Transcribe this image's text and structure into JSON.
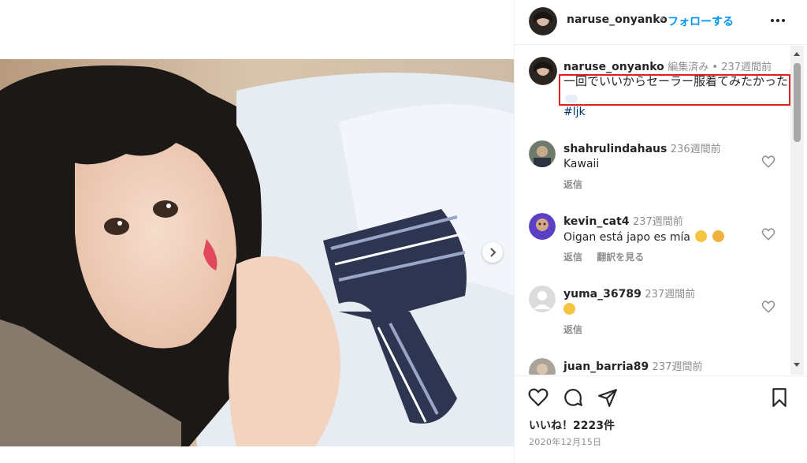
{
  "header": {
    "username": "naruse_onyanko",
    "separator": "•",
    "follow_label": "フォローする",
    "more_icon": "more-horizontal-icon"
  },
  "caption": {
    "username": "naruse_onyanko",
    "meta": "編集済み • 237週間前",
    "text": "一回でいいからセーラー服着てみたかった",
    "hashtag": "#ljk"
  },
  "comments": [
    {
      "username": "shahrulindahaus",
      "time": "236週間前",
      "text": "Kawaii",
      "actions": [
        "返信"
      ]
    },
    {
      "username": "kevin_cat4",
      "time": "237週間前",
      "text": "Oigan está japo es mía",
      "actions": [
        "返信",
        "翻訳を見る"
      ]
    },
    {
      "username": "yuma_36789",
      "time": "237週間前",
      "text": "",
      "actions": [
        "返信"
      ]
    },
    {
      "username": "juan_barria89",
      "time": "237週間前",
      "text": "",
      "actions": []
    }
  ],
  "actions": {
    "likes": "いいね！2223件",
    "date": "2020年12月15日"
  },
  "colors": {
    "link_blue": "#0095f6",
    "hashtag": "#00376b",
    "muted": "#8e8e8e",
    "highlight_box": "#e02020"
  }
}
